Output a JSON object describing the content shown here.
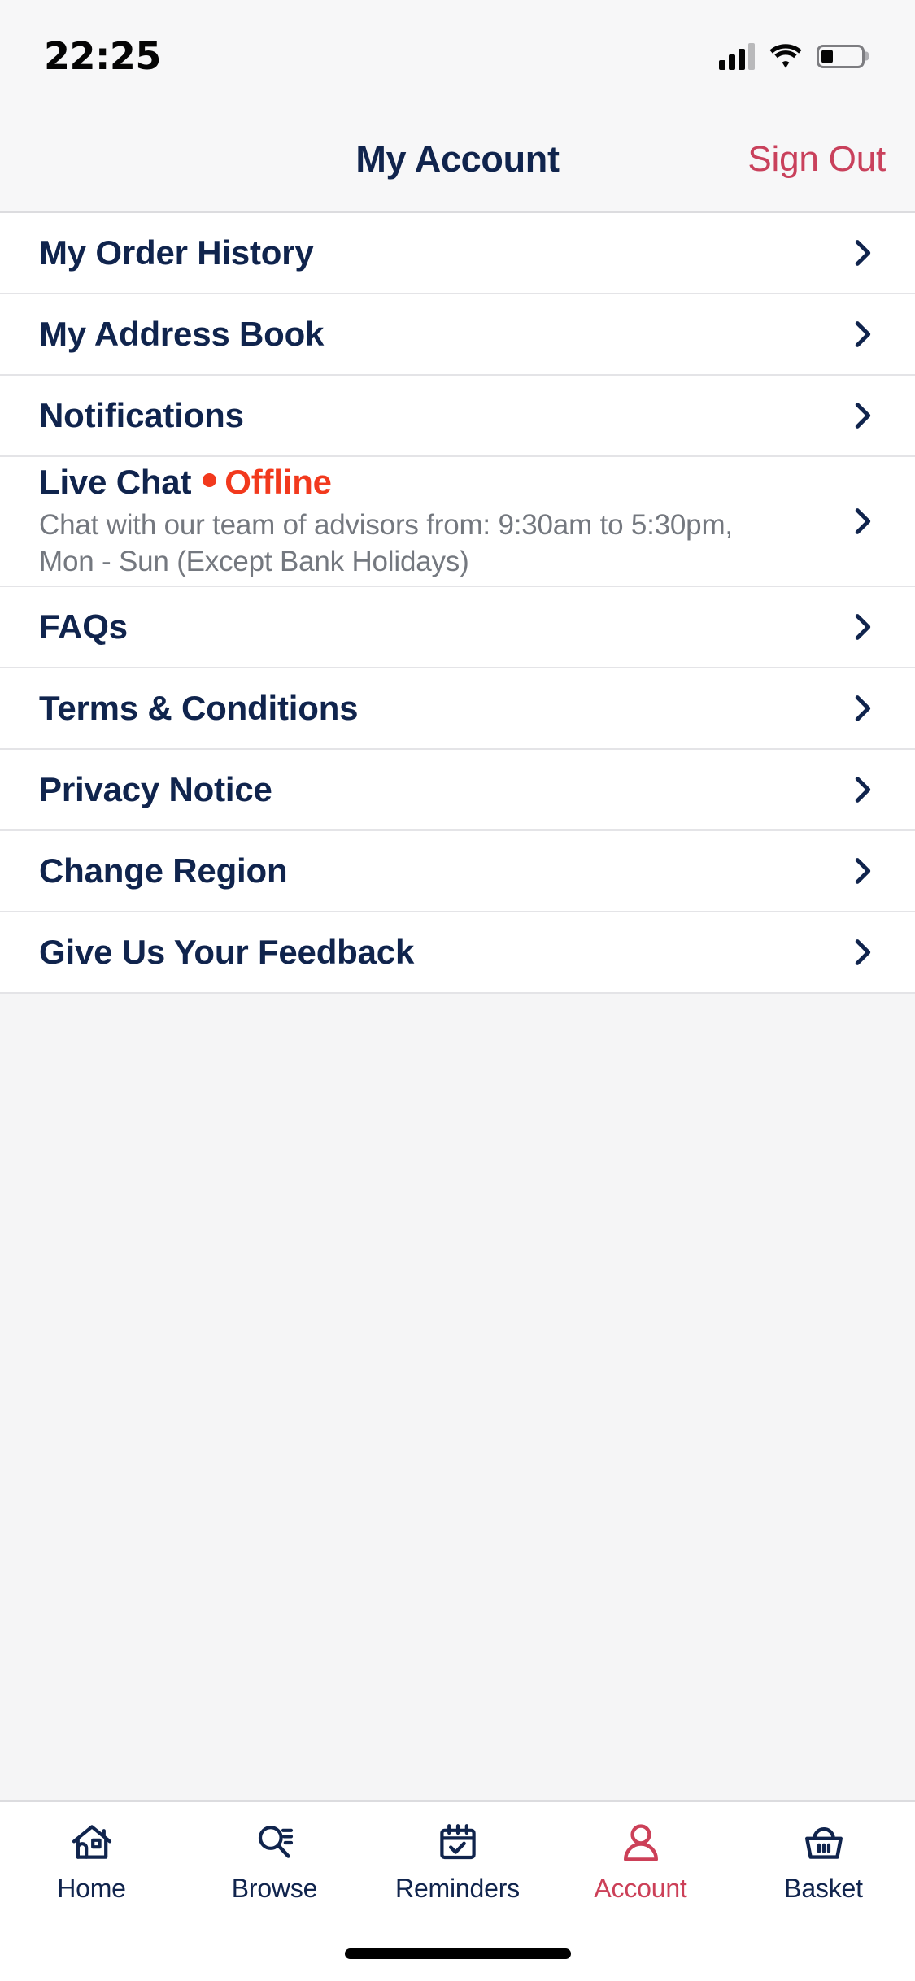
{
  "status_bar": {
    "time": "22:25",
    "signal_icon": "cellular-signal-icon",
    "wifi_icon": "wifi-icon",
    "battery_icon": "battery-low-icon",
    "battery_level_percent": 28
  },
  "header": {
    "title": "My Account",
    "sign_out_label": "Sign Out"
  },
  "colors": {
    "navy": "#10244d",
    "crimson": "#c9415c",
    "accent_red": "#f2391d",
    "muted_text": "#74787f",
    "divider": "#e4e4e7",
    "page_background": "#f5f5f6"
  },
  "menu": {
    "items": [
      {
        "label": "My Order History",
        "subtitle": "",
        "status": "",
        "chevron": "chevron-right-icon"
      },
      {
        "label": "My Address Book",
        "subtitle": "",
        "status": "",
        "chevron": "chevron-right-icon"
      },
      {
        "label": "Notifications",
        "subtitle": "",
        "status": "",
        "chevron": "chevron-right-icon"
      },
      {
        "label": "Live Chat",
        "status": "Offline",
        "subtitle": "Chat with our team of advisors from: 9:30am to 5:30pm, Mon - Sun (Except Bank Holidays)",
        "chevron": "chevron-right-icon"
      },
      {
        "label": "FAQs",
        "subtitle": "",
        "status": "",
        "chevron": "chevron-right-icon"
      },
      {
        "label": "Terms & Conditions",
        "subtitle": "",
        "status": "",
        "chevron": "chevron-right-icon"
      },
      {
        "label": "Privacy Notice",
        "subtitle": "",
        "status": "",
        "chevron": "chevron-right-icon"
      },
      {
        "label": "Change Region",
        "subtitle": "",
        "status": "",
        "chevron": "chevron-right-icon"
      },
      {
        "label": "Give Us Your Feedback",
        "subtitle": "",
        "status": "",
        "chevron": "chevron-right-icon"
      }
    ]
  },
  "tab_bar": {
    "items": [
      {
        "label": "Home",
        "icon": "house-icon",
        "active": false
      },
      {
        "label": "Browse",
        "icon": "magnifier-list-icon",
        "active": false
      },
      {
        "label": "Reminders",
        "icon": "calendar-check-icon",
        "active": false
      },
      {
        "label": "Account",
        "icon": "person-icon",
        "active": true
      },
      {
        "label": "Basket",
        "icon": "basket-icon",
        "active": false
      }
    ]
  }
}
